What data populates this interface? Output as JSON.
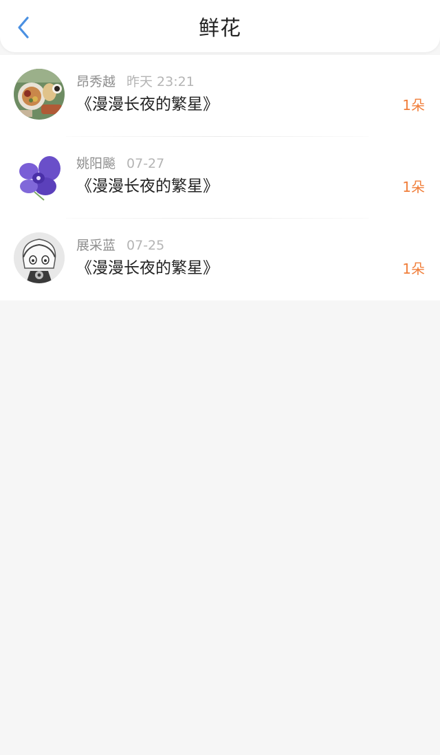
{
  "header": {
    "title": "鲜花",
    "back_icon": "chevron-left-icon"
  },
  "colors": {
    "accent_blue": "#4a90e2",
    "count_orange": "#f07e3a",
    "background": "#f6f6f6"
  },
  "records": [
    {
      "username": "昂秀越",
      "timestamp": "昨天 23:21",
      "book_title": "《漫漫长夜的繁星》",
      "count": "1朵",
      "avatar": "food-plate-avatar"
    },
    {
      "username": "姚阳飈",
      "timestamp": "07-27",
      "book_title": "《漫漫长夜的繁星》",
      "count": "1朵",
      "avatar": "purple-orchid-avatar"
    },
    {
      "username": "展采蓝",
      "timestamp": "07-25",
      "book_title": "《漫漫长夜的繁星》",
      "count": "1朵",
      "avatar": "anime-sketch-avatar"
    }
  ]
}
